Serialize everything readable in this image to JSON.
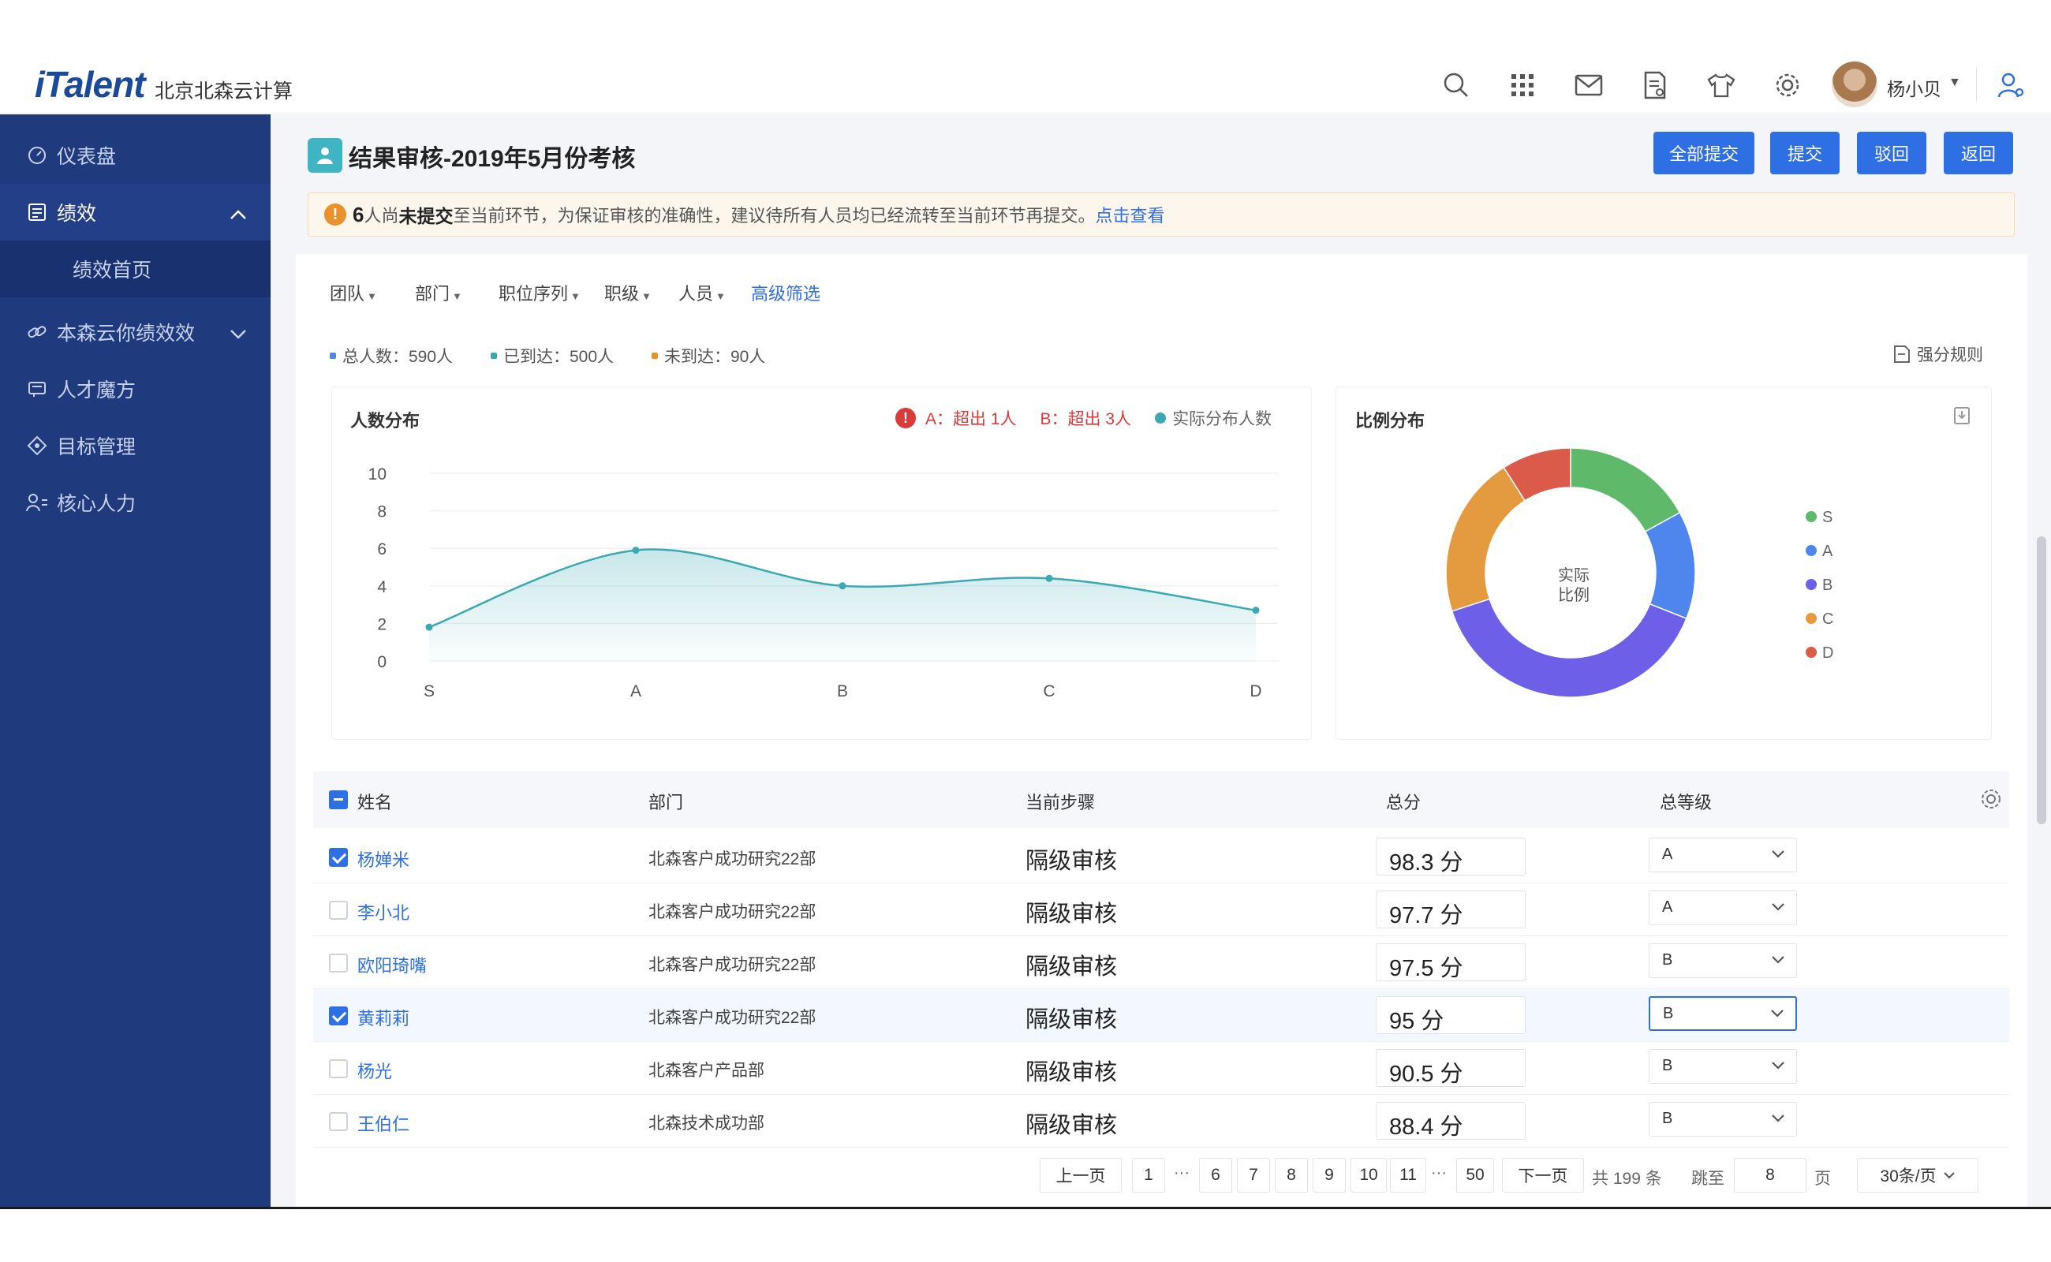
{
  "app": {
    "logo": "iTalent",
    "company": "北京北森云计算",
    "username": "杨小贝"
  },
  "sidebar": {
    "items": [
      {
        "label": "仪表盘",
        "icon": "dashboard-icon"
      },
      {
        "label": "绩效",
        "icon": "performance-icon"
      },
      {
        "label": "绩效首页"
      },
      {
        "label": "本森云你绩效效",
        "icon": "link-icon"
      },
      {
        "label": "人才魔方",
        "icon": "cube-icon"
      },
      {
        "label": "目标管理",
        "icon": "target-icon"
      },
      {
        "label": "核心人力",
        "icon": "people-icon"
      }
    ]
  },
  "page": {
    "title": "结果审核-2019年5月份考核",
    "buttons": {
      "submit_all": "全部提交",
      "submit": "提交",
      "reject": "驳回",
      "back": "返回"
    }
  },
  "warning": {
    "count": "6",
    "count_suffix": "人尚",
    "bold": "未提交",
    "text": "至当前环节，为保证审核的准确性，建议待所有人员均已经流转至当前环节再提交。",
    "link": "点击查看"
  },
  "filters": [
    "团队",
    "部门",
    "职位序列",
    "职级",
    "人员"
  ],
  "advanced_filter": "高级筛选",
  "stats": {
    "total": "总人数：590人",
    "arrived": "已到达：500人",
    "not_arrived": "未到达：90人",
    "rule_link": "强分规则"
  },
  "line_panel": {
    "title": "人数分布",
    "legend_a": "A：超出 1人",
    "legend_b": "B：超出 3人",
    "legend_actual": "实际分布人数"
  },
  "pie_panel": {
    "title": "比例分布",
    "center_line1": "实际",
    "center_line2": "比例"
  },
  "chart_data": [
    {
      "type": "line",
      "title": "人数分布",
      "x": [
        "S",
        "A",
        "B",
        "C",
        "D"
      ],
      "series": [
        {
          "name": "实际分布人数",
          "values": [
            1.8,
            5.9,
            4.0,
            4.4,
            2.7
          ]
        }
      ],
      "ylim": [
        0,
        10
      ],
      "yticks": [
        0,
        2,
        4,
        6,
        8,
        10
      ],
      "color": "#3aa9b4"
    },
    {
      "type": "pie",
      "title": "比例分布",
      "categories": [
        "S",
        "A",
        "B",
        "C",
        "D"
      ],
      "values": [
        17,
        14,
        39,
        21,
        9
      ],
      "colors": [
        "#5fb96b",
        "#4e86ee",
        "#6d5fe8",
        "#e49a3e",
        "#db5a49"
      ]
    }
  ],
  "table": {
    "headers": {
      "name": "姓名",
      "dept": "部门",
      "step": "当前步骤",
      "score": "总分",
      "grade": "总等级"
    },
    "rows": [
      {
        "name": "杨婵米",
        "dept": "北森客户成功研究22部",
        "step": "隔级审核",
        "score": "98.3 分",
        "grade": "A",
        "checked": true
      },
      {
        "name": "李小北",
        "dept": "北森客户成功研究22部",
        "step": "隔级审核",
        "score": "97.7 分",
        "grade": "A",
        "checked": false
      },
      {
        "name": "欧阳琦嘴",
        "dept": "北森客户成功研究22部",
        "step": "隔级审核",
        "score": "97.5 分",
        "grade": "B",
        "checked": false
      },
      {
        "name": "黄莉莉",
        "dept": "北森客户成功研究22部",
        "step": "隔级审核",
        "score": "95 分",
        "grade": "B",
        "checked": true
      },
      {
        "name": "杨光",
        "dept": "北森客户产品部",
        "step": "隔级审核",
        "score": "90.5 分",
        "grade": "B",
        "checked": false
      },
      {
        "name": "王伯仁",
        "dept": "北森技术成功部",
        "step": "隔级审核",
        "score": "88.4 分",
        "grade": "B",
        "checked": false
      }
    ]
  },
  "pagination": {
    "prev": "上一页",
    "pages": [
      "1",
      "6",
      "7",
      "8",
      "9",
      "10",
      "11",
      "50"
    ],
    "next": "下一页",
    "total": "共 199 条",
    "goto_label": "跳至",
    "goto_value": "8",
    "page_suffix": "页",
    "page_size": "30条/页"
  }
}
